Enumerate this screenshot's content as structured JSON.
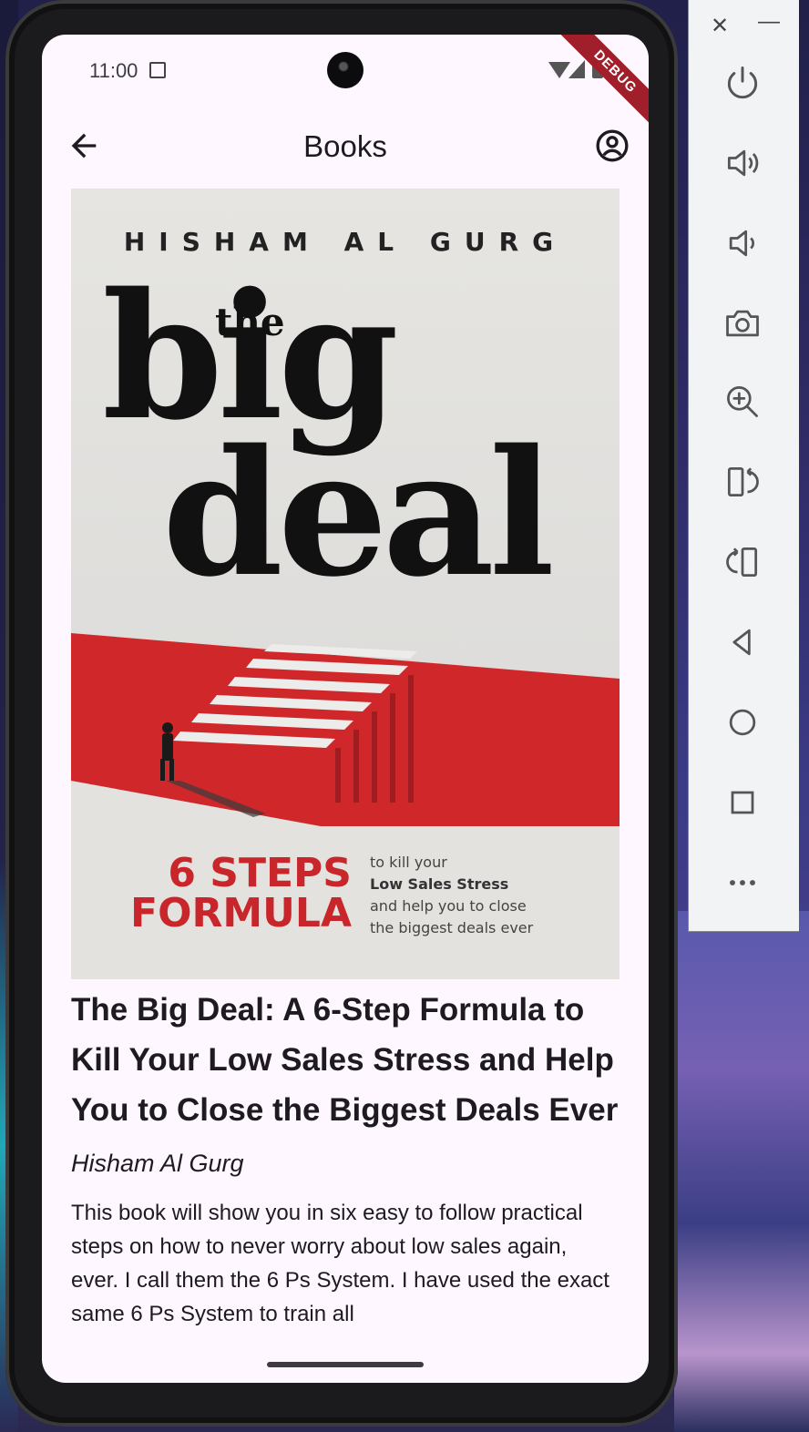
{
  "status_bar": {
    "time": "11:00",
    "debug_banner": "DEBUG"
  },
  "app_bar": {
    "title": "Books",
    "back_icon": "arrow-back-icon",
    "account_icon": "account-circle-icon"
  },
  "cover": {
    "author": "HISHAM AL GURG",
    "the": "the",
    "big": "big",
    "deal": "deal",
    "steps_line1": "6 STEPS",
    "steps_line2": "FORMULA",
    "tag_line1": "to kill your",
    "tag_line2": "Low Sales Stress",
    "tag_line3": "and help you to close",
    "tag_line4": "the biggest deals ever",
    "colors": {
      "red": "#d0282a",
      "background": "#e3e2df"
    }
  },
  "book": {
    "title": "The Big Deal: A 6-Step Formula to Kill Your Low Sales Stress and Help You to Close the Biggest Deals Ever",
    "author": "Hisham Al Gurg",
    "description": "This book will show you in six easy to follow practical steps on how to never worry about low sales again, ever. I call them the 6 Ps System. I have used the exact same 6 Ps System to train all"
  },
  "emulator_panel": {
    "window_controls": {
      "close": "✕",
      "minimize": "—"
    },
    "tools": [
      "power-icon",
      "volume-up-icon",
      "volume-down-icon",
      "camera-icon",
      "zoom-in-icon",
      "rotate-left-icon",
      "rotate-right-icon",
      "back-icon",
      "home-icon",
      "overview-icon",
      "more-icon"
    ]
  }
}
